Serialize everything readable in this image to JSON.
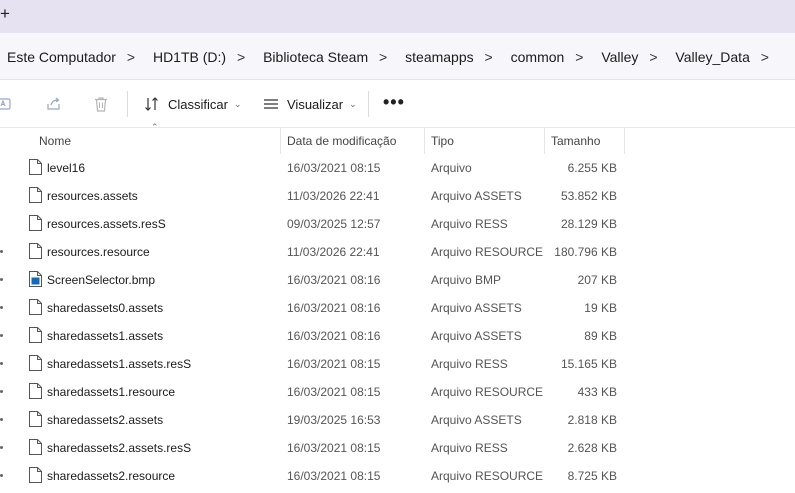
{
  "tabbar": {
    "new_tab_label": "+"
  },
  "breadcrumb": [
    "Este Computador",
    "HD1TB (D:)",
    "Biblioteca Steam",
    "steamapps",
    "common",
    "Valley",
    "Valley_Data"
  ],
  "breadcrumb_separator": ">",
  "toolbar": {
    "sort_label": "Classificar",
    "view_label": "Visualizar",
    "more_label": "•••",
    "icons": [
      "rename-icon",
      "share-icon",
      "delete-icon",
      "sort-icon",
      "view-icon",
      "more-icon"
    ]
  },
  "columns": {
    "name": "Nome",
    "date": "Data de modificação",
    "type": "Tipo",
    "size": "Tamanho"
  },
  "files": [
    {
      "name": "level16",
      "date": "16/03/2021 08:15",
      "type": "Arquivo",
      "size": "6.255 KB",
      "icon": "file-icon"
    },
    {
      "name": "resources.assets",
      "date": "11/03/2026 22:41",
      "type": "Arquivo ASSETS",
      "size": "53.852 KB",
      "icon": "file-icon"
    },
    {
      "name": "resources.assets.resS",
      "date": "09/03/2025 12:57",
      "type": "Arquivo RESS",
      "size": "28.129 KB",
      "icon": "file-icon"
    },
    {
      "name": "resources.resource",
      "date": "11/03/2026 22:41",
      "type": "Arquivo RESOURCE",
      "size": "180.796 KB",
      "icon": "file-icon"
    },
    {
      "name": "ScreenSelector.bmp",
      "date": "16/03/2021 08:16",
      "type": "Arquivo BMP",
      "size": "207 KB",
      "icon": "image-file-icon"
    },
    {
      "name": "sharedassets0.assets",
      "date": "16/03/2021 08:16",
      "type": "Arquivo ASSETS",
      "size": "19 KB",
      "icon": "file-icon"
    },
    {
      "name": "sharedassets1.assets",
      "date": "16/03/2021 08:16",
      "type": "Arquivo ASSETS",
      "size": "89 KB",
      "icon": "file-icon"
    },
    {
      "name": "sharedassets1.assets.resS",
      "date": "16/03/2021 08:15",
      "type": "Arquivo RESS",
      "size": "15.165 KB",
      "icon": "file-icon"
    },
    {
      "name": "sharedassets1.resource",
      "date": "16/03/2021 08:15",
      "type": "Arquivo RESOURCE",
      "size": "433 KB",
      "icon": "file-icon"
    },
    {
      "name": "sharedassets2.assets",
      "date": "19/03/2025 16:53",
      "type": "Arquivo ASSETS",
      "size": "2.818 KB",
      "icon": "file-icon"
    },
    {
      "name": "sharedassets2.assets.resS",
      "date": "16/03/2021 08:15",
      "type": "Arquivo RESS",
      "size": "2.628 KB",
      "icon": "file-icon"
    },
    {
      "name": "sharedassets2.resource",
      "date": "16/03/2021 08:15",
      "type": "Arquivo RESOURCE",
      "size": "8.725 KB",
      "icon": "file-icon"
    }
  ],
  "colors": {
    "tabbar_bg": "#e6e2f1",
    "addressbar_bg": "#f7f6fb",
    "accent": "#0f6cbd"
  }
}
